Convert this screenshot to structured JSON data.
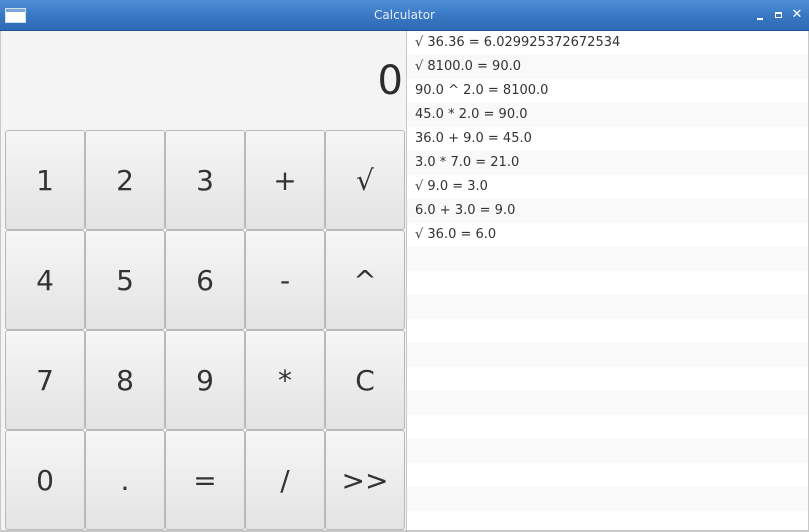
{
  "window": {
    "title": "Calculator",
    "controls": {
      "close": "✕"
    }
  },
  "display": {
    "value": "0"
  },
  "keys": [
    [
      "1",
      "2",
      "3",
      "+",
      "√"
    ],
    [
      "4",
      "5",
      "6",
      "-",
      "^"
    ],
    [
      "7",
      "8",
      "9",
      "*",
      "C"
    ],
    [
      "0",
      ".",
      "=",
      "/",
      ">>"
    ]
  ],
  "history": [
    "√ 36.36 = 6.029925372672534",
    "√ 8100.0 = 90.0",
    "90.0 ^ 2.0 = 8100.0",
    "45.0 * 2.0 = 90.0",
    "36.0 + 9.0 = 45.0",
    "3.0 * 7.0 = 21.0",
    "√ 9.0 = 3.0",
    "6.0 + 3.0 = 9.0",
    "√ 36.0 = 6.0"
  ]
}
